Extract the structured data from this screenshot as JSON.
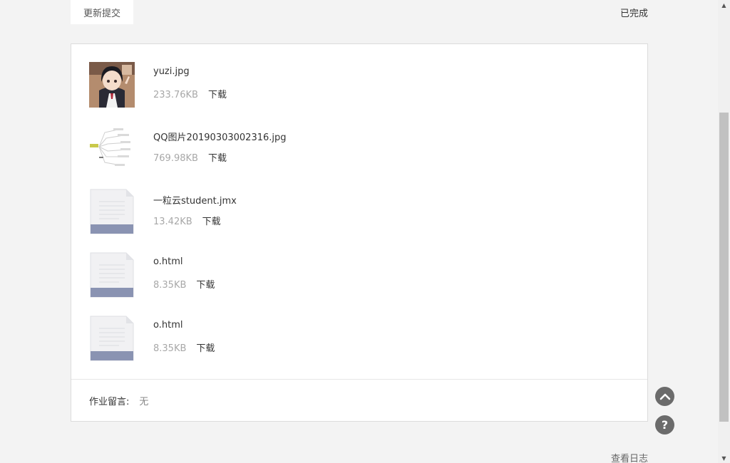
{
  "header": {
    "update_tab_label": "更新提交",
    "status_label": "已完成"
  },
  "files": [
    {
      "name": "yuzi.jpg",
      "size": "233.76KB",
      "download_label": "下载",
      "icon": "image-thumbnail-anime-girl"
    },
    {
      "name": "QQ图片20190303002316.jpg",
      "size": "769.98KB",
      "download_label": "下载",
      "icon": "image-thumbnail-mindmap"
    },
    {
      "name": "一粒云student.jmx",
      "size": "13.42KB",
      "download_label": "下载",
      "icon": "document-file-icon"
    },
    {
      "name": "o.html",
      "size": "8.35KB",
      "download_label": "下载",
      "icon": "document-file-icon"
    },
    {
      "name": "o.html",
      "size": "8.35KB",
      "download_label": "下载",
      "icon": "document-file-icon"
    }
  ],
  "comment": {
    "label": "作业留言:",
    "value": "无"
  },
  "footer": {
    "log_link": "查看日志"
  },
  "floating": {
    "top_icon": "chevron-up-icon",
    "help_label": "?"
  }
}
